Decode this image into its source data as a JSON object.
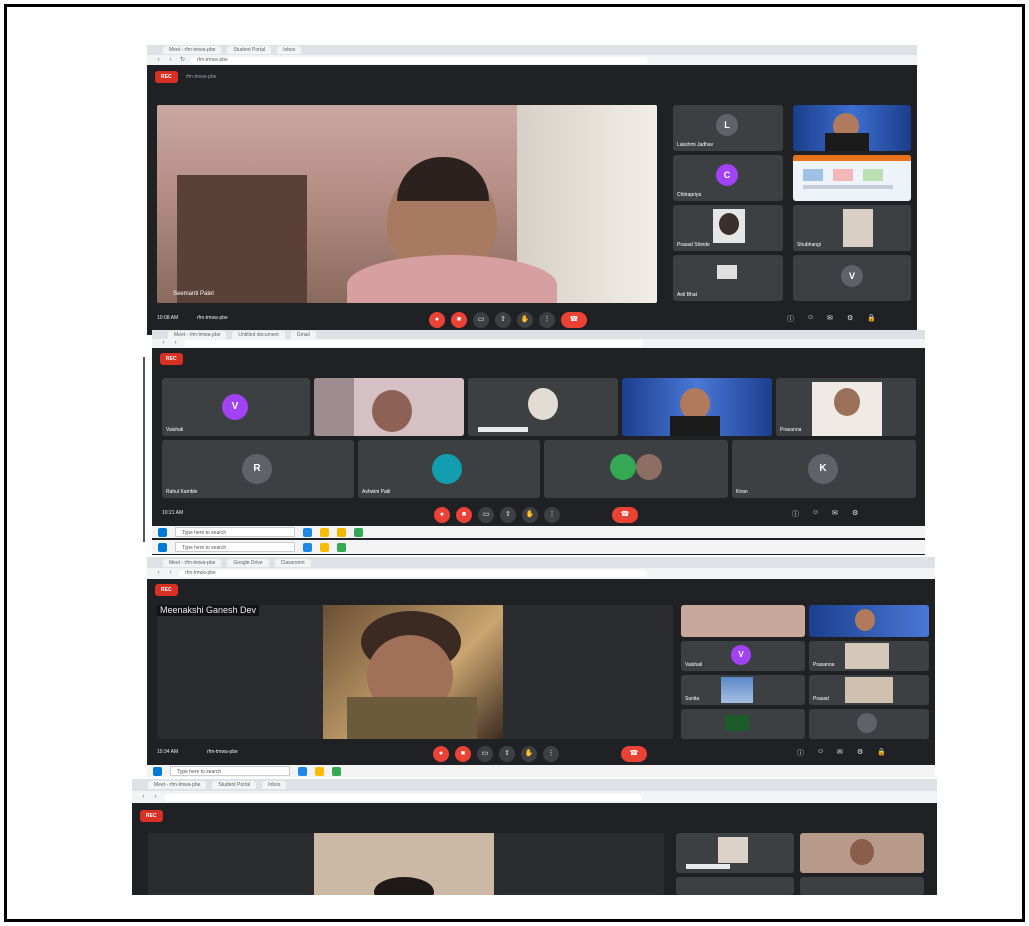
{
  "window": {
    "background": "#202124",
    "accent_red": "#ea4335"
  },
  "panels": [
    {
      "tabs": [
        "Meet - rfm-tmwa-pbe",
        "Student Portal",
        "Inbox"
      ],
      "rec_label": "REC",
      "main_speaker": "Seemanti Patel",
      "meeting_time": "10:08 AM",
      "meeting_code": "rfm-tmwa-pbe",
      "grid": [
        {
          "label": "Lakshmi Jadhav",
          "type": "avatar",
          "initial": "L",
          "color": "#5f6368"
        },
        {
          "label": "",
          "type": "video"
        },
        {
          "label": "Chitrapriya",
          "type": "avatar",
          "initial": "C",
          "color": "#a142f4"
        },
        {
          "label": "",
          "type": "screen"
        },
        {
          "label": "Prasad Shinde",
          "type": "video"
        },
        {
          "label": "Shubhangi",
          "type": "video"
        },
        {
          "label": "Anil Bhat",
          "type": "video"
        },
        {
          "label": "",
          "type": "avatar",
          "initial": "V",
          "color": "#5f6368"
        }
      ]
    },
    {
      "tabs": [
        "Meet - rfm-tmwa-pbe",
        "Untitled document",
        "Gmail"
      ],
      "rec_label": "REC",
      "meeting_time": "10:21 AM",
      "row1": [
        {
          "label": "Vaishali",
          "type": "avatar",
          "initial": "V",
          "color": "#a142f4"
        },
        {
          "label": "",
          "type": "video"
        },
        {
          "label": "",
          "type": "video"
        },
        {
          "label": "",
          "type": "video"
        },
        {
          "label": "Prasanna",
          "type": "video"
        }
      ],
      "row2": [
        {
          "label": "Rahul Kamble",
          "type": "avatar",
          "initial": "R",
          "color": "#5f6368"
        },
        {
          "label": "Ashwini Patil",
          "type": "avatar",
          "initial": "",
          "color": "#129eaf"
        },
        {
          "label": "",
          "type": "avatar",
          "initial": "",
          "color": "#34a853"
        },
        {
          "label": "Kiran",
          "type": "avatar",
          "initial": "K",
          "color": "#5f6368"
        }
      ]
    },
    {
      "tabs": [
        "Meet - rfm-tmwa-pbe",
        "Google Drive",
        "Classroom"
      ],
      "rec_label": "REC",
      "main_speaker": "Meenakshi Ganesh Dev",
      "meeting_time": "10:34 AM",
      "meeting_code": "rfm-tmwa-pbe",
      "grid": [
        {
          "label": "",
          "type": "video"
        },
        {
          "label": "",
          "type": "video"
        },
        {
          "label": "Vaishali",
          "type": "avatar",
          "initial": "V",
          "color": "#a142f4"
        },
        {
          "label": "Prasanna",
          "type": "video"
        },
        {
          "label": "Sunita",
          "type": "video"
        },
        {
          "label": "Prasad",
          "type": "video"
        },
        {
          "label": "",
          "type": "video"
        },
        {
          "label": "",
          "type": "avatar",
          "initial": "",
          "color": "#5f6368"
        }
      ]
    },
    {
      "tabs": [
        "Meet - rfm-tmwa-pbe",
        "Student Portal",
        "Inbox"
      ],
      "rec_label": "REC"
    }
  ],
  "taskbar": {
    "search_placeholder": "Type here to search"
  }
}
